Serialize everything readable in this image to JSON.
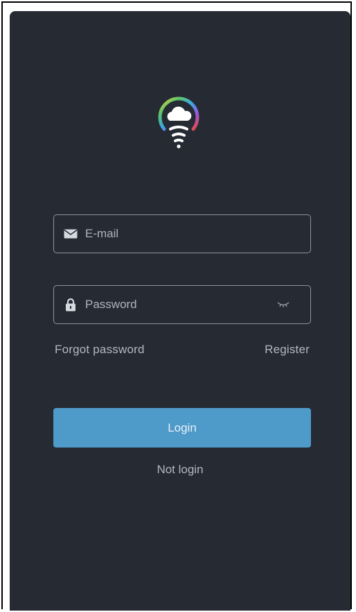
{
  "app": {
    "logo_icon": "lightbulb-cloud-wifi-logo-icon"
  },
  "email": {
    "icon": "envelope-icon",
    "placeholder": "E-mail",
    "value": ""
  },
  "password": {
    "icon": "lock-icon",
    "placeholder": "Password",
    "value": "",
    "toggle_icon": "eye-closed-icon"
  },
  "links": {
    "forgot": "Forgot password",
    "register": "Register"
  },
  "actions": {
    "login": "Login",
    "not_login": "Not login"
  },
  "colors": {
    "background": "#252a33",
    "accent": "#4e9ac9",
    "field_border": "#8f96a1",
    "text_muted": "#b2b8c1"
  }
}
